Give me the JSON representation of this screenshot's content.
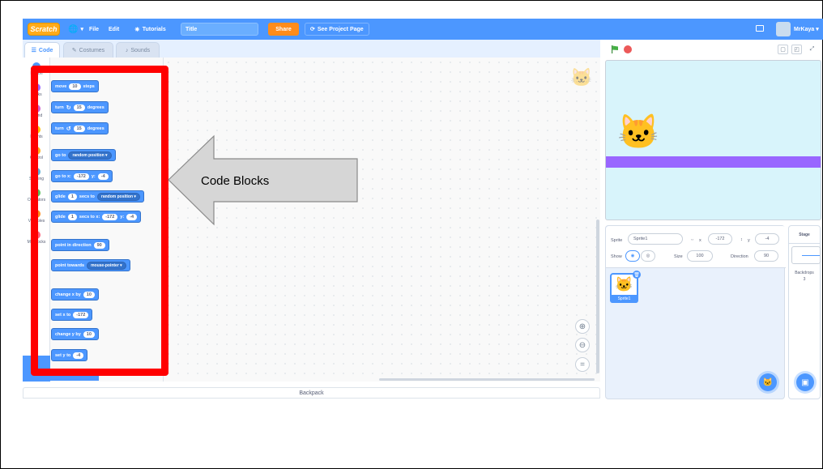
{
  "menubar": {
    "logo": "Scratch",
    "file": "File",
    "edit": "Edit",
    "tutorials": "Tutorials",
    "title_value": "Title",
    "share": "Share",
    "see_project_page": "See Project Page",
    "username": "MrKaya"
  },
  "tabs": {
    "code": "Code",
    "costumes": "Costumes",
    "sounds": "Sounds"
  },
  "categories": [
    {
      "label": "Motion",
      "color": "#4c97ff"
    },
    {
      "label": "Looks",
      "color": "#9966ff"
    },
    {
      "label": "Sound",
      "color": "#cf63cf"
    },
    {
      "label": "Events",
      "color": "#ffbf00"
    },
    {
      "label": "Control",
      "color": "#ffab19"
    },
    {
      "label": "Sensing",
      "color": "#5cb1d6"
    },
    {
      "label": "Operators",
      "color": "#59c059"
    },
    {
      "label": "Variables",
      "color": "#ff8c1a"
    },
    {
      "label": "My Blocks",
      "color": "#ff6680"
    }
  ],
  "blocks": {
    "move": {
      "pre": "move",
      "val": "10",
      "post": "steps"
    },
    "turn_right": {
      "pre": "turn",
      "val": "15",
      "post": "degrees"
    },
    "turn_left": {
      "pre": "turn",
      "val": "15",
      "post": "degrees"
    },
    "go_to": {
      "pre": "go to",
      "drop": "random position"
    },
    "go_to_xy": {
      "pre": "go to x:",
      "x": "-172",
      "ylab": "y:",
      "y": "-4"
    },
    "glide_to": {
      "pre": "glide",
      "val": "1",
      "mid": "secs to",
      "drop": "random position"
    },
    "glide_xy": {
      "pre": "glide",
      "val": "1",
      "mid": "secs to x:",
      "x": "-172",
      "ylab": "y:",
      "y": "-4"
    },
    "point_dir": {
      "pre": "point in direction",
      "val": "90"
    },
    "point_towards": {
      "pre": "point towards",
      "drop": "mouse-pointer"
    },
    "change_x": {
      "pre": "change x by",
      "val": "10"
    },
    "set_x": {
      "pre": "set x to",
      "val": "-172"
    },
    "change_y": {
      "pre": "change y by",
      "val": "10"
    },
    "set_y": {
      "pre": "set y to",
      "val": "-4"
    }
  },
  "annotation": {
    "label": "Code Blocks",
    "box_color": "#ff0000"
  },
  "backpack": "Backpack",
  "sprite_info": {
    "sprite_label": "Sprite",
    "sprite_name": "Sprite1",
    "x_label": "x",
    "x_value": "-172",
    "y_label": "y",
    "y_value": "-4",
    "show_label": "Show",
    "size_label": "Size",
    "size_value": "100",
    "direction_label": "Direction",
    "direction_value": "90",
    "thumb_name": "Sprite1"
  },
  "stage_pane": {
    "header": "Stage",
    "backdrops_label": "Backdrops",
    "backdrops_count": "3"
  },
  "colors": {
    "accent": "#4c97ff",
    "menubar": "#4c97ff",
    "share": "#ff8c1a",
    "ground": "#9966ff",
    "stage_bg": "#d8f4fb"
  }
}
